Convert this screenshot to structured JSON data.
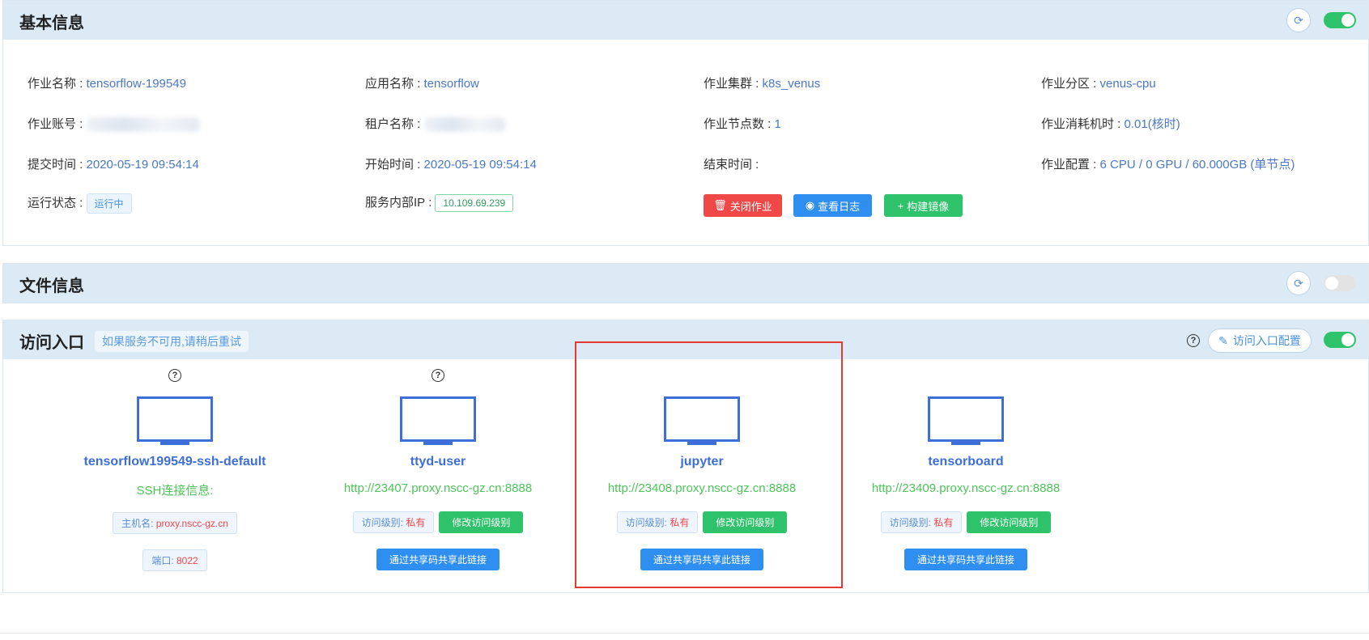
{
  "basic": {
    "title": "基本信息",
    "fields": {
      "job_name_label": "作业名称 : ",
      "job_name": "tensorflow-199549",
      "app_name_label": "应用名称 : ",
      "app_name": "tensorflow",
      "cluster_label": "作业集群 : ",
      "cluster": "k8s_venus",
      "partition_label": "作业分区 : ",
      "partition": "venus-cpu",
      "account_label": "作业账号 : ",
      "tenant_label": "租户名称 : ",
      "node_count_label": "作业节点数 : ",
      "node_count": "1",
      "cost_label": "作业消耗机时 : ",
      "cost": "0.01(核时)",
      "submit_label": "提交时间 : ",
      "submit_time": "2020-05-19 09:54:14",
      "start_label": "开始时间 : ",
      "start_time": "2020-05-19 09:54:14",
      "end_label": "结束时间 : ",
      "config_label": "作业配置 : ",
      "config": "6 CPU / 0 GPU / 60.000GB (单节点)",
      "status_label": "运行状态 : ",
      "status": "运行中",
      "ip_label": "服务内部IP : ",
      "ip": "10.109.69.239"
    },
    "buttons": {
      "close": "关闭作业",
      "logs": "查看日志",
      "build": "构建镜像"
    }
  },
  "files": {
    "title": "文件信息"
  },
  "access": {
    "title": "访问入口",
    "hint": "如果服务不可用,请稍后重试",
    "config_button": "访问入口配置",
    "entries": [
      {
        "name": "tensorflow199549-ssh-default",
        "subtitle": "SSH连接信息:",
        "host_label": "主机名: ",
        "host": "proxy.nscc-gz.cn",
        "port_label": "端口: ",
        "port": "8022"
      },
      {
        "name": "ttyd-user",
        "url": "http://23407.proxy.nscc-gz.cn:8888",
        "level_label": "访问级别: ",
        "level": "私有",
        "modify": "修改访问级别",
        "share": "通过共享码共享此链接"
      },
      {
        "name": "jupyter",
        "url": "http://23408.proxy.nscc-gz.cn:8888",
        "level_label": "访问级别: ",
        "level": "私有",
        "modify": "修改访问级别",
        "share": "通过共享码共享此链接"
      },
      {
        "name": "tensorboard",
        "url": "http://23409.proxy.nscc-gz.cn:8888",
        "level_label": "访问级别: ",
        "level": "私有",
        "modify": "修改访问级别",
        "share": "通过共享码共享此链接"
      }
    ]
  }
}
